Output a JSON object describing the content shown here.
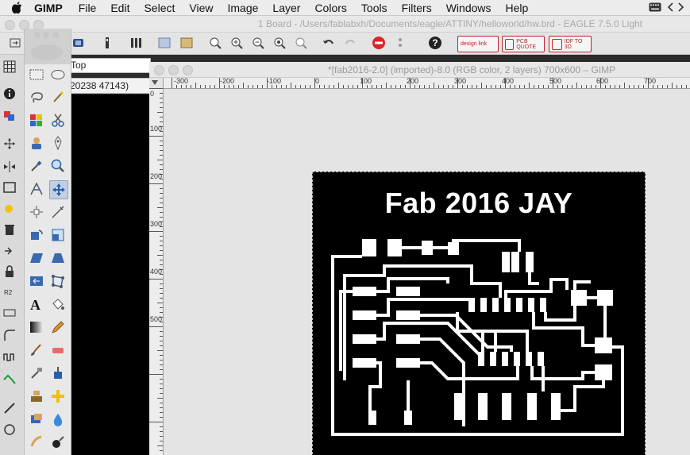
{
  "menubar": {
    "app": "GIMP",
    "items": [
      "File",
      "Edit",
      "Select",
      "View",
      "Image",
      "Layer",
      "Colors",
      "Tools",
      "Filters",
      "Windows",
      "Help"
    ]
  },
  "eagle": {
    "title": "1 Board - /Users/fablabxh/Documents/eagle/ATTINY/helloworld/hw.brd - EAGLE 7.5.0 Light",
    "layer": "Top",
    "coord": "20238 47143)",
    "buttons": {
      "design": "design link",
      "pcb": "PCB QUOTE",
      "idf": "IDF TO 3D"
    }
  },
  "gimp": {
    "title": "*[fab2016-2.0] (imported)-8.0 (RGB color, 2 layers) 700x600 – GIMP",
    "hruler_ticks": [
      "-300",
      "-200",
      "-100",
      "0",
      "100",
      "200",
      "300",
      "400",
      "500",
      "600",
      "700"
    ],
    "vruler_ticks": [
      "0",
      "100",
      "200",
      "300",
      "400",
      "500"
    ],
    "canvas_text": "Fab 2016 JAY"
  }
}
